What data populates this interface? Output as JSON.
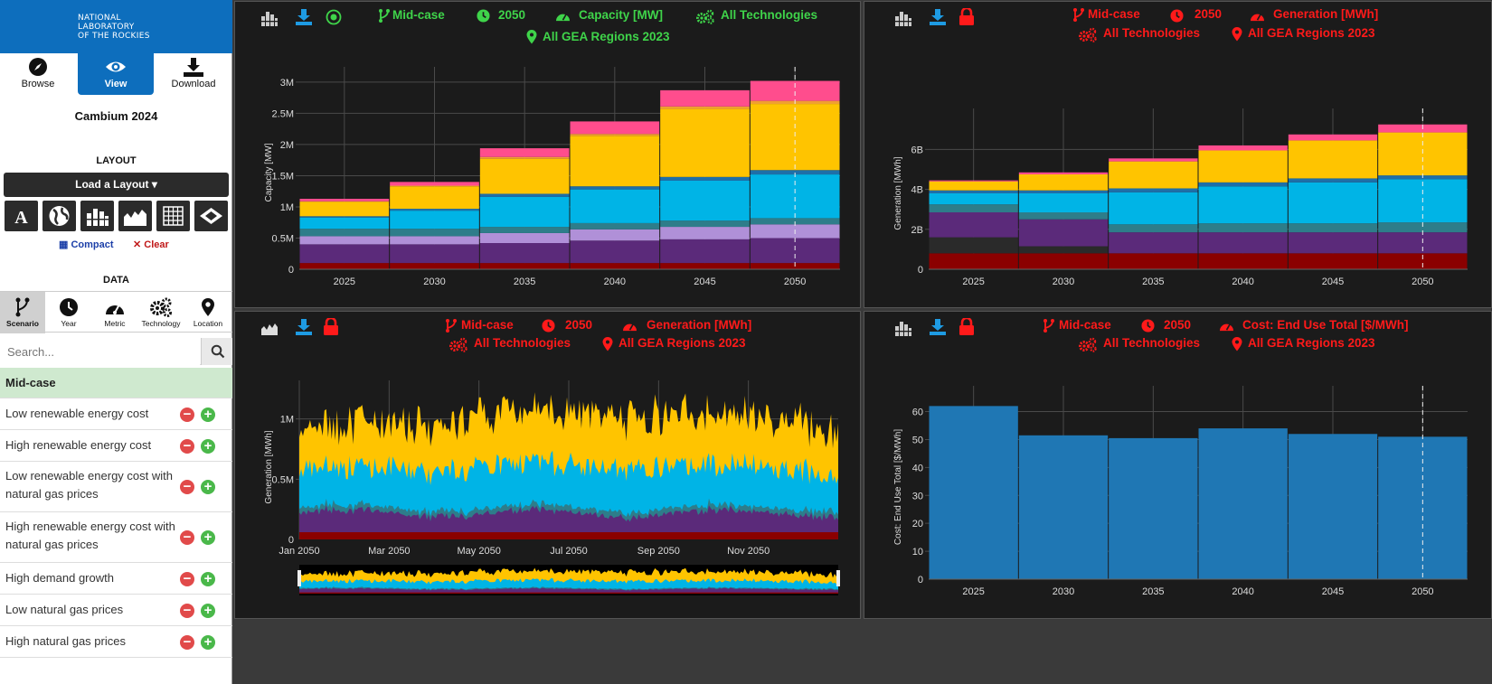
{
  "sidebar": {
    "logo": "NATIONAL\nLABORATORY\nOF THE ROCKIES",
    "modes": [
      {
        "label": "Browse",
        "icon": "compass-icon"
      },
      {
        "label": "View",
        "icon": "eye-icon"
      },
      {
        "label": "Download",
        "icon": "download-icon"
      }
    ],
    "title": "Cambium 2024",
    "layout_label": "LAYOUT",
    "load_layout": "Load a Layout ▾",
    "compact": "Compact",
    "clear": "Clear",
    "data_label": "DATA",
    "data_tabs": [
      {
        "label": "Scenario",
        "icon": "scenario-branch-icon"
      },
      {
        "label": "Year",
        "icon": "clock-icon"
      },
      {
        "label": "Metric",
        "icon": "gauge-icon"
      },
      {
        "label": "Technology",
        "icon": "gears-icon"
      },
      {
        "label": "Location",
        "icon": "map-pin-icon"
      }
    ],
    "search_placeholder": "Search...",
    "scenarios": [
      {
        "label": "Mid-case",
        "active": true
      },
      {
        "label": "Low renewable energy cost"
      },
      {
        "label": "High renewable energy cost"
      },
      {
        "label": "Low renewable energy cost with natural gas prices"
      },
      {
        "label": "High renewable energy cost with natural gas prices"
      },
      {
        "label": "High demand growth"
      },
      {
        "label": "Low natural gas prices"
      },
      {
        "label": "High natural gas prices"
      }
    ]
  },
  "colors": {
    "accent": "#0d6ebd",
    "green": "#3fd44a",
    "red": "#ff1a1a",
    "series": [
      "#8b0000",
      "#2a2a2a",
      "#5b2a7a",
      "#b090d8",
      "#2e7d8a",
      "#00b4e6",
      "#1e6fa8",
      "#ffc400",
      "#f0a030",
      "#ff4d8d"
    ]
  },
  "panels": [
    {
      "scenario": "Mid-case",
      "year": "2050",
      "metric": "Capacity [MW]",
      "technology": "All Technologies",
      "region": "All GEA Regions 2023",
      "locked": false,
      "status_icon": "target-icon",
      "chart_data": {
        "type": "bar",
        "stacked": true,
        "categories": [
          "2025",
          "2030",
          "2035",
          "2040",
          "2045",
          "2050"
        ],
        "ylabel": "Capacity [MW]",
        "yticks": [
          "0",
          "0.5M",
          "1M",
          "1.5M",
          "2M",
          "2.5M",
          "3M"
        ],
        "ylim": [
          0,
          3100000
        ],
        "series": [
          {
            "color": "#8b0000",
            "values": [
              100000,
              100000,
              100000,
              100000,
              100000,
              100000
            ]
          },
          {
            "color": "#5b2a7a",
            "values": [
              300000,
              300000,
              320000,
              360000,
              380000,
              400000
            ]
          },
          {
            "color": "#b090d8",
            "values": [
              130000,
              130000,
              160000,
              180000,
              200000,
              220000
            ]
          },
          {
            "color": "#2e7d8a",
            "values": [
              120000,
              120000,
              100000,
              100000,
              100000,
              100000
            ]
          },
          {
            "color": "#00b4e6",
            "values": [
              180000,
              290000,
              480000,
              540000,
              640000,
              700000
            ]
          },
          {
            "color": "#1e6fa8",
            "values": [
              20000,
              30000,
              50000,
              50000,
              60000,
              70000
            ]
          },
          {
            "color": "#ffc400",
            "values": [
              230000,
              360000,
              560000,
              810000,
              1090000,
              1060000
            ]
          },
          {
            "color": "#f0a030",
            "values": [
              10000,
              10000,
              30000,
              30000,
              40000,
              50000
            ]
          },
          {
            "color": "#ff4d8d",
            "values": [
              40000,
              60000,
              140000,
              200000,
              260000,
              320000
            ]
          }
        ]
      }
    },
    {
      "scenario": "Mid-case",
      "year": "2050",
      "metric": "Generation [MWh]",
      "technology": "All Technologies",
      "region": "All GEA Regions 2023",
      "locked": true,
      "chart_data": {
        "type": "bar",
        "stacked": true,
        "categories": [
          "2025",
          "2030",
          "2035",
          "2040",
          "2045",
          "2050"
        ],
        "ylabel": "Generation [MWh]",
        "yticks": [
          "0",
          "2B",
          "4B",
          "6B"
        ],
        "ylim": [
          0,
          7600000000
        ],
        "series": [
          {
            "color": "#8b0000",
            "values": [
              800000000,
              800000000,
              800000000,
              800000000,
              800000000,
              800000000
            ]
          },
          {
            "color": "#2a2a2a",
            "values": [
              800000000,
              350000000,
              0,
              0,
              0,
              0
            ]
          },
          {
            "color": "#5b2a7a",
            "values": [
              1250000000,
              1350000000,
              1050000000,
              1050000000,
              1050000000,
              1050000000
            ]
          },
          {
            "color": "#2e7d8a",
            "values": [
              400000000,
              350000000,
              400000000,
              450000000,
              450000000,
              500000000
            ]
          },
          {
            "color": "#00b4e6",
            "values": [
              550000000,
              950000000,
              1600000000,
              1850000000,
              2050000000,
              2150000000
            ]
          },
          {
            "color": "#1e6fa8",
            "values": [
              150000000,
              150000000,
              200000000,
              200000000,
              200000000,
              200000000
            ]
          },
          {
            "color": "#ffc400",
            "values": [
              450000000,
              800000000,
              1350000000,
              1600000000,
              1900000000,
              2150000000
            ]
          },
          {
            "color": "#ff4d8d",
            "values": [
              50000000,
              100000000,
              150000000,
              250000000,
              300000000,
              400000000
            ]
          }
        ]
      }
    },
    {
      "scenario": "Mid-case",
      "year": "2050",
      "metric": "Generation [MWh]",
      "technology": "All Technologies",
      "region": "All GEA Regions 2023",
      "locked": true,
      "chart_data": {
        "type": "area",
        "stacked": true,
        "xticks": [
          "Jan 2050",
          "Mar 2050",
          "May 2050",
          "Jul 2050",
          "Sep 2050",
          "Nov 2050"
        ],
        "ylabel": "Generation [MWh]",
        "yticks": [
          "0",
          "0.5M",
          "1M"
        ],
        "ylim": [
          0,
          1200000
        ]
      }
    },
    {
      "scenario": "Mid-case",
      "year": "2050",
      "metric": "Cost: End Use Total [$/MWh]",
      "technology": "All Technologies",
      "region": "All GEA Regions 2023",
      "locked": true,
      "chart_data": {
        "type": "bar",
        "categories": [
          "2025",
          "2030",
          "2035",
          "2040",
          "2045",
          "2050"
        ],
        "values": [
          62,
          51.5,
          50.5,
          54,
          52,
          51
        ],
        "ylabel": "Cost: End Use Total [$/MWh]",
        "yticks": [
          "0",
          "10",
          "20",
          "30",
          "40",
          "50",
          "60"
        ],
        "ylim": [
          0,
          66
        ],
        "color": "#1f77b4"
      }
    }
  ]
}
